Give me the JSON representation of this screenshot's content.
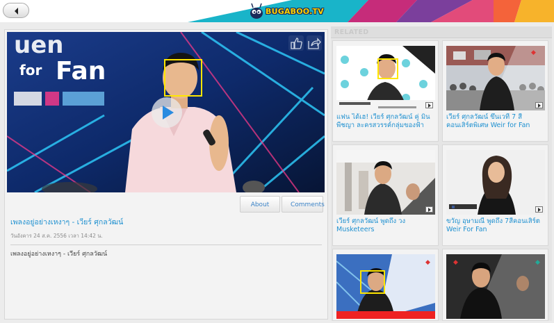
{
  "header": {
    "logo_text": "BUGABOO.TV",
    "back_icon": "chevron-left-icon",
    "stripe_colors": [
      "#19b4c9",
      "#c62c7a",
      "#7b3f9c",
      "#f4633a",
      "#f7b32b"
    ]
  },
  "player": {
    "icons": [
      "thumbs-up-icon",
      "share-icon",
      "play-icon"
    ],
    "tabs": [
      {
        "label": "About"
      },
      {
        "label": "Comments"
      }
    ]
  },
  "video_info": {
    "title": "เพลงอยู่อย่างเหงาๆ - เวียร์ ศุกลวัฒน์",
    "date": "วันอังคาร 24 ส.ค. 2556 เวลา 14:42 น.",
    "description": "เพลงอยู่อย่างเหงาๆ - เวียร์ ศุกลวัฒน์"
  },
  "related": {
    "title": "RELATED",
    "items": [
      {
        "title": "แฟน ได้เฮ! เวียร์ ศุกลวัฒน์ คู่ มิน พีชญา ละครสวรรค์กลุ่มของฟ้า"
      },
      {
        "title": "เวียร์ ศุกลวัฒน์ ขึ้นเวที 7 สีคอนเสิร์ตพิเศษ Weir for Fan"
      },
      {
        "title": "เวียร์ ศุกลวัฒน์ พูดถึง วง Musketeers"
      },
      {
        "title": "ขวัญ อุษามณี พูดถึง 7สีคอนเสิร์ต Weir For Fan"
      },
      {
        "title": ""
      },
      {
        "title": ""
      }
    ]
  },
  "colors": {
    "link": "#1e90d0",
    "face_box": "#ffe600"
  }
}
